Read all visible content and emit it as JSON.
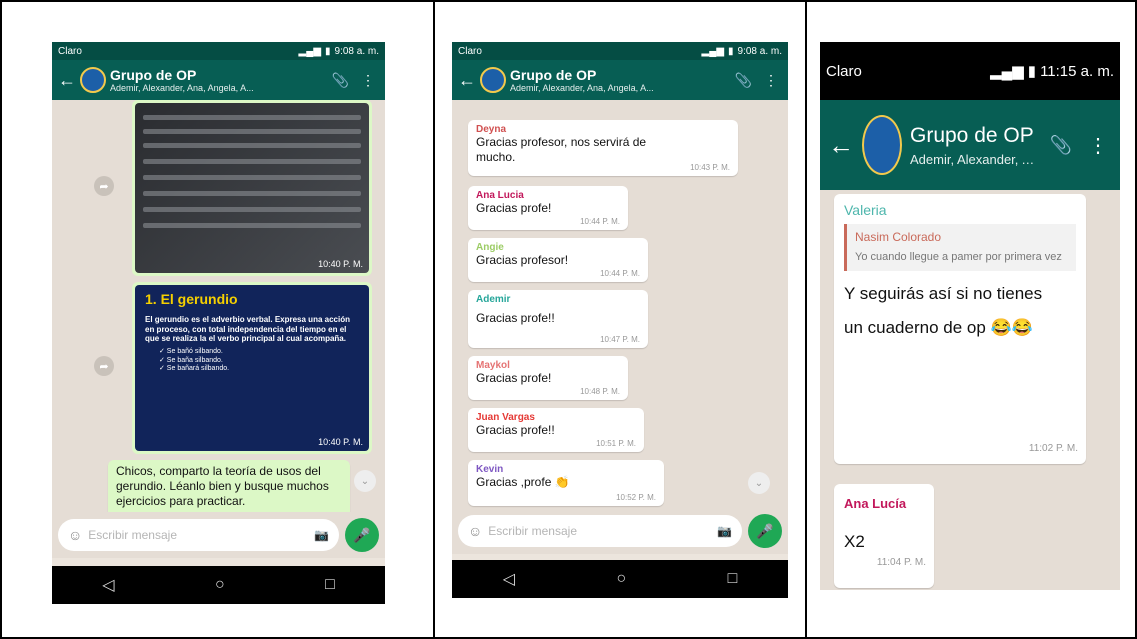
{
  "common": {
    "group_title": "Grupo de OP",
    "members": "Ademir, Alexander, Ana, Angela, A...",
    "placeholder": "Escribir mensaje",
    "nav_back": "◁",
    "nav_home": "○",
    "nav_recent": "□"
  },
  "phone1": {
    "carrier": "Claro",
    "clock": "9:08 a. m.",
    "image1_time": "10:40 P. M.",
    "image2_title": "1. El gerundio",
    "image2_body": "El gerundio es el adverbio verbal. Expresa una acción en proceso, con total independencia del tiempo en el que se realiza la el verbo principal al cual acompaña.",
    "image2_ex1": "✓ Se bañó silbando.",
    "image2_ex2": "✓ Se baña silbando.",
    "image2_ex3": "✓ Se bañará silbando.",
    "image2_time": "10:40 P. M.",
    "outgoing_text": "Chicos, comparto la teoría de usos del gerundio. Léanlo bien y busque muchos ejercicios para practicar."
  },
  "phone2": {
    "carrier": "Claro",
    "clock": "9:08 a. m.",
    "messages": [
      {
        "sender": "Deyna",
        "color": "#d05050",
        "text": "Gracias profesor, nos servirá de mucho.",
        "time": "10:43 P. M."
      },
      {
        "sender": "Ana Lucia",
        "color": "#c2185b",
        "text": "Gracias profe!",
        "time": "10:44 P. M."
      },
      {
        "sender": "Angie",
        "color": "#9ccc65",
        "text": "Gracias profesor!",
        "time": "10:44 P. M."
      },
      {
        "sender": "Ademir",
        "color": "#26a69a",
        "text": "Gracias profe!!",
        "time": "10:47 P. M."
      },
      {
        "sender": "Maykol",
        "color": "#e57373",
        "text": "Gracias profe!",
        "time": "10:48 P. M."
      },
      {
        "sender": "Juan Vargas",
        "color": "#e53935",
        "text": "Gracias profe!!",
        "time": "10:51 P. M."
      },
      {
        "sender": "Kevin",
        "color": "#7e57c2",
        "text": "Gracias ,profe 👏",
        "time": "10:52 P. M."
      }
    ]
  },
  "phone3": {
    "carrier": "Claro",
    "clock": "11:15 a. m.",
    "msg1_sender": "Valeria",
    "msg1_quote_name": "Nasim Colorado",
    "msg1_quote_text": "Yo cuando llegue a pamer por primera vez",
    "msg1_text": "Y seguirás así si no tienes un cuaderno de op 😂😂",
    "msg1_time": "11:02 P. M.",
    "msg2_sender": "Ana Lucía",
    "msg2_text": "X2",
    "msg2_time": "11:04 P. M."
  }
}
